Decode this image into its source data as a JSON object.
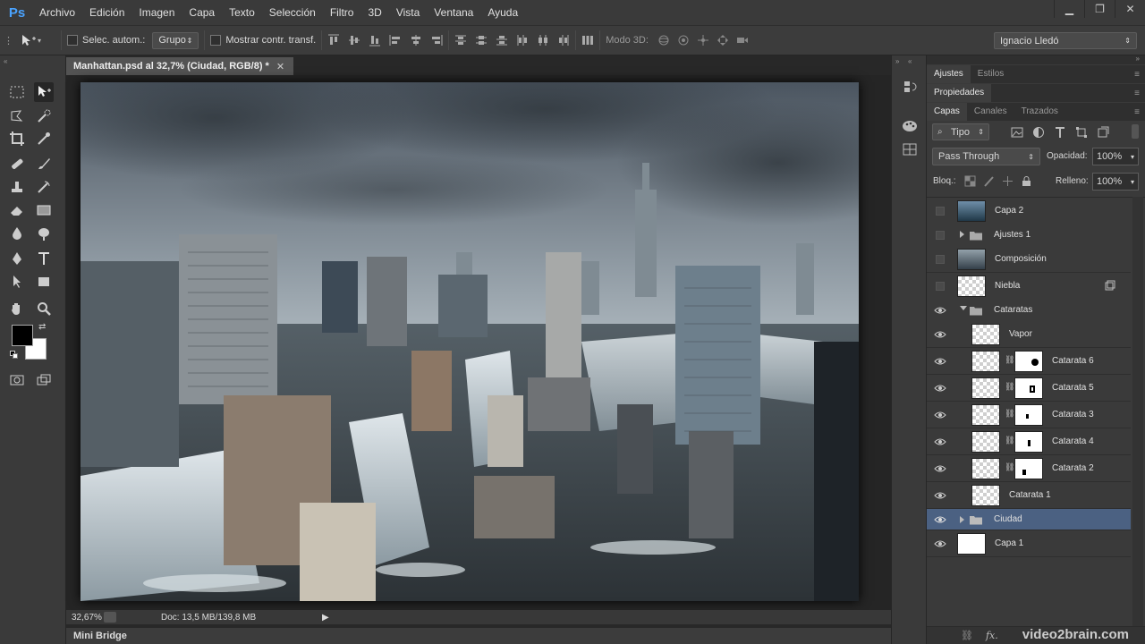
{
  "menubar": {
    "logo": "Ps",
    "items": [
      "Archivo",
      "Edición",
      "Imagen",
      "Capa",
      "Texto",
      "Selección",
      "Filtro",
      "3D",
      "Vista",
      "Ventana",
      "Ayuda"
    ]
  },
  "options": {
    "auto_select_label": "Selec. autom.:",
    "auto_select_value": "Grupo",
    "transform_label": "Mostrar contr. transf.",
    "mode3d_label": "Modo 3D:",
    "workspace": "Ignacio Lledó"
  },
  "document": {
    "tab_title": "Manhattan.psd al 32,7% (Ciudad, RGB/8) *",
    "zoom": "32,67%",
    "doc_info": "Doc: 13,5 MB/139,8 MB",
    "mini_bridge": "Mini Bridge"
  },
  "panels": {
    "row1": [
      "Ajustes",
      "Estilos"
    ],
    "row2": [
      "Propiedades"
    ],
    "row3": [
      "Capas",
      "Canales",
      "Trazados"
    ],
    "filter_kind": "Tipo",
    "blend_mode": "Pass Through",
    "opacity_label": "Opacidad:",
    "opacity_value": "100%",
    "lock_label": "Bloq.:",
    "fill_label": "Relleno:",
    "fill_value": "100%"
  },
  "layers": [
    {
      "name": "Capa 2",
      "visible": false,
      "type": "image"
    },
    {
      "name": "Ajustes 1",
      "visible": false,
      "type": "group"
    },
    {
      "name": "Composición",
      "visible": false,
      "type": "image"
    },
    {
      "name": "Niebla",
      "visible": false,
      "type": "transparent"
    },
    {
      "name": "Cataratas",
      "visible": true,
      "type": "group-open"
    },
    {
      "name": "Vapor",
      "visible": true,
      "type": "child"
    },
    {
      "name": "Catarata 6",
      "visible": true,
      "type": "child-mask"
    },
    {
      "name": "Catarata 5",
      "visible": true,
      "type": "child-mask"
    },
    {
      "name": "Catarata 3",
      "visible": true,
      "type": "child-mask"
    },
    {
      "name": "Catarata 4",
      "visible": true,
      "type": "child-mask"
    },
    {
      "name": "Catarata 2",
      "visible": true,
      "type": "child-mask"
    },
    {
      "name": "Catarata 1",
      "visible": true,
      "type": "child"
    },
    {
      "name": "Ciudad",
      "visible": true,
      "type": "group",
      "selected": true
    },
    {
      "name": "Capa 1",
      "visible": true,
      "type": "white"
    }
  ],
  "watermark": "video2brain.com",
  "colors": {
    "accent": "#4aa3ff",
    "selection": "#4b6182",
    "foreground": "#000000",
    "background": "#ffffff"
  }
}
